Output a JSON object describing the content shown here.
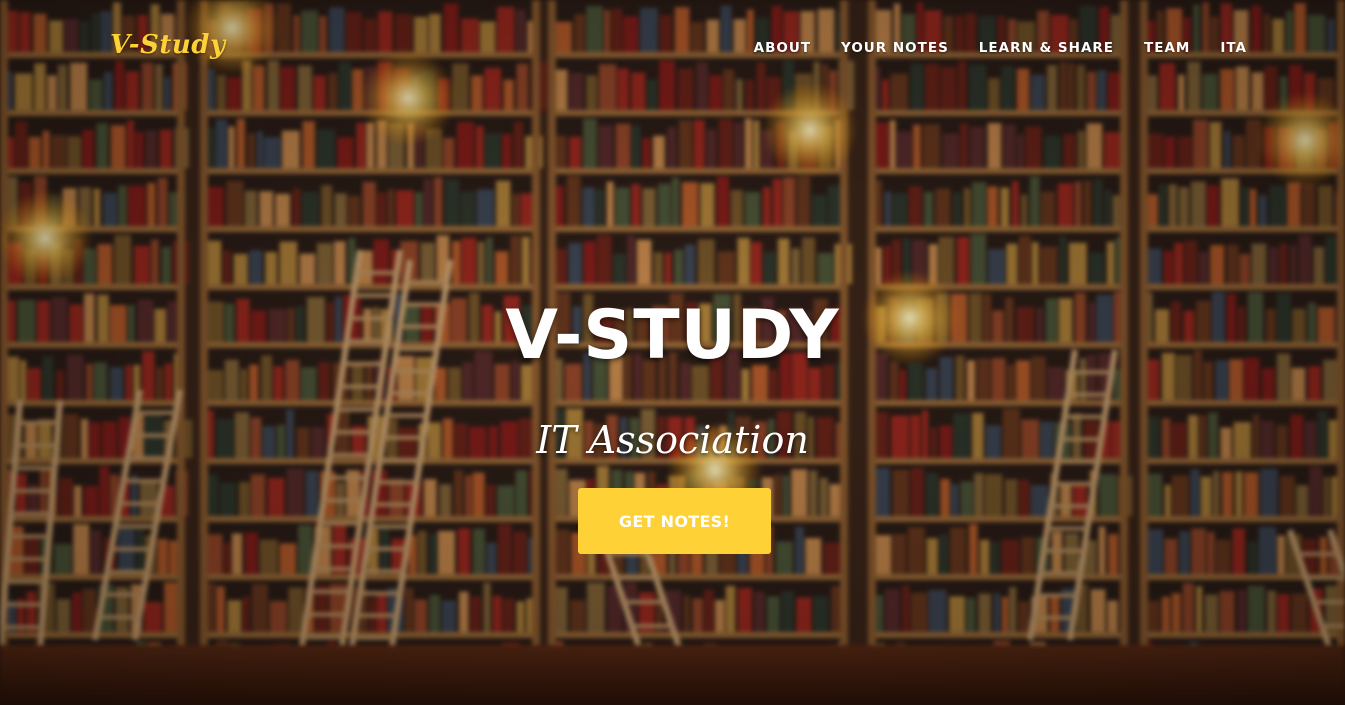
{
  "brand": {
    "name": "V-Study"
  },
  "nav": {
    "items": [
      "ABOUT",
      "YOUR NOTES",
      "LEARN & SHARE",
      "TEAM",
      "ITA"
    ]
  },
  "hero": {
    "title": "V-STUDY",
    "subtitle": "IT Association",
    "cta_label": "GET NOTES!"
  },
  "colors": {
    "accent": "#fed136",
    "text": "#ffffff"
  }
}
